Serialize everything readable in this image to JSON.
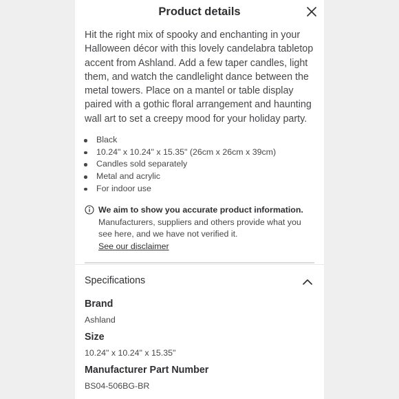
{
  "header": {
    "title": "Product details",
    "close_icon": "close-icon"
  },
  "description": "Hit the right mix of spooky and enchanting in your Halloween décor with this lovely candelabra tabletop accent from Ashland. Add a few taper candles, light them, and watch the candlelight dance between the metal towers. Place on a mantel or table display paired with a gothic floral arrangement and haunting wall art to set a creepy mood for your holiday party.",
  "features": [
    "Black",
    "10.24\" x 10.24\" x 15.35\" (26cm x 26cm x 39cm)",
    "Candles sold separately",
    "Metal and acrylic",
    "For indoor use"
  ],
  "notice": {
    "icon": "info-icon",
    "heading": "We aim to show you accurate product information.",
    "body": "Manufacturers, suppliers and others provide what you see here, and we have not verified it.",
    "link": "See our disclaimer"
  },
  "specifications": {
    "title": "Specifications",
    "toggle_icon": "chevron-up-icon",
    "rows": [
      {
        "label": "Brand",
        "value": "Ashland"
      },
      {
        "label": "Size",
        "value": "10.24\" x 10.24\" x 15.35\""
      },
      {
        "label": "Manufacturer Part Number",
        "value": "BS04-506BG-BR"
      }
    ]
  }
}
